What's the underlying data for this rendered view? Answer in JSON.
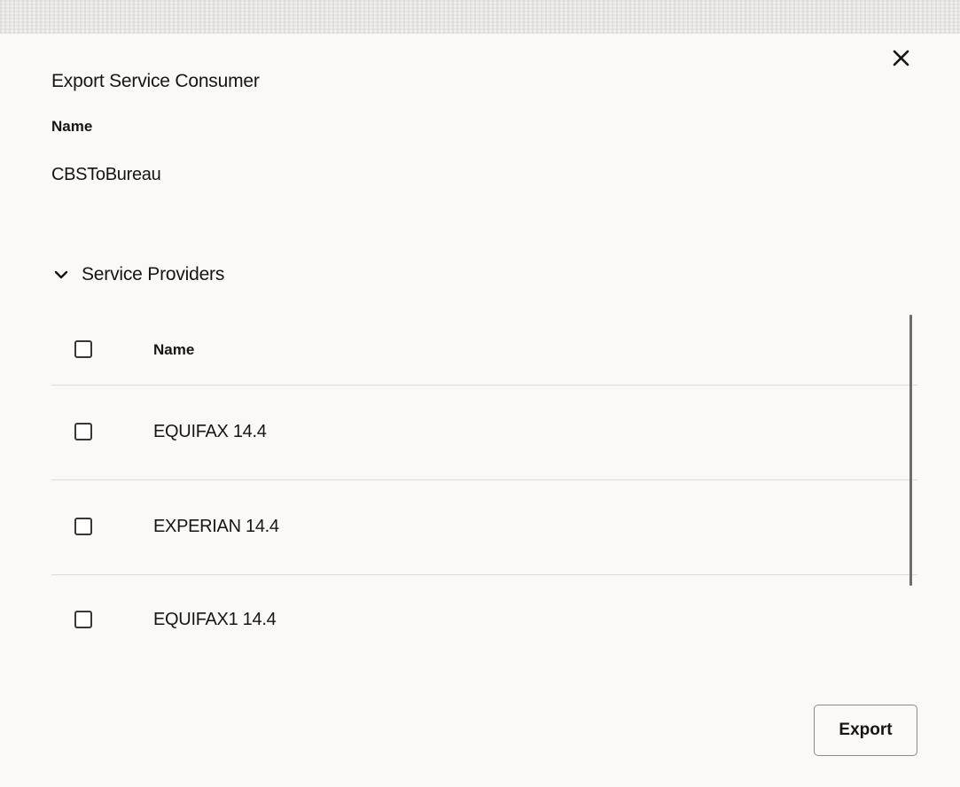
{
  "dialog": {
    "title": "Export Service Consumer",
    "close_icon": "close-icon"
  },
  "consumer": {
    "name_label": "Name",
    "name_value": "CBSToBureau"
  },
  "providers_section": {
    "label": "Service Providers",
    "expanded": true,
    "toggle_icon": "chevron-down-icon",
    "table": {
      "column_header": "Name",
      "rows": [
        {
          "name": "EQUIFAX 14.4",
          "checked": false
        },
        {
          "name": "EXPERIAN 14.4",
          "checked": false
        },
        {
          "name": "EQUIFAX1 14.4",
          "checked": false
        }
      ]
    }
  },
  "footer": {
    "export_label": "Export"
  },
  "colors": {
    "background": "#fbf9f8",
    "text": "#161513",
    "divider": "#dedbd7",
    "border": "#8d8a86"
  }
}
